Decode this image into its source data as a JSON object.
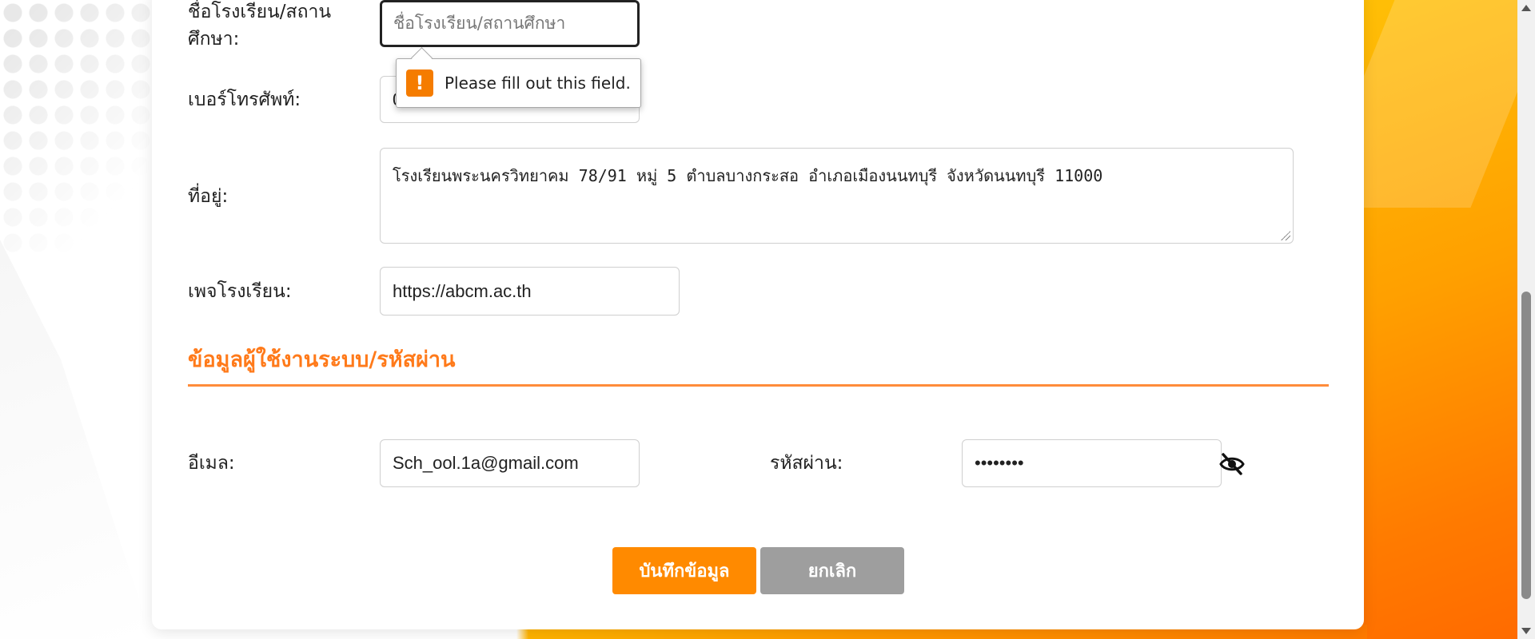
{
  "form": {
    "school_name": {
      "label": "ชื่อโรงเรียน/สถานศึกษา:",
      "placeholder": "ชื่อโรงเรียน/สถานศึกษา",
      "value": ""
    },
    "phone": {
      "label": "เบอร์โทรศัพท์:",
      "value_partial": "0"
    },
    "address": {
      "label": "ที่อยู่:",
      "value": "โรงเรียนพระนครวิทยาคม 78/91 หมู่ 5 ตำบลบางกระสอ อำเภอเมืองนนทบุรี จังหวัดนนทบุรี 11000"
    },
    "page": {
      "label": "เพจโรงเรียน:",
      "value": "https://abcm.ac.th"
    }
  },
  "validation_tooltip": {
    "message": "Please fill out this field.",
    "icon": "!"
  },
  "account_section": {
    "title": "ข้อมูลผู้ใช้งานระบบ/รหัสผ่าน",
    "email": {
      "label": "อีเมล:",
      "value": "Sch_ool.1a@gmail.com"
    },
    "password": {
      "label": "รหัสผ่าน:",
      "value": "••••••••",
      "toggle_icon": "eye-slash-icon"
    }
  },
  "actions": {
    "save_label": "บันทึกข้อมูล",
    "cancel_label": "ยกเลิก"
  },
  "colors": {
    "accent": "#ff7a1a",
    "save_button": "#ff8a00",
    "cancel_button": "#9e9e9e",
    "warning": "#f57c00"
  }
}
